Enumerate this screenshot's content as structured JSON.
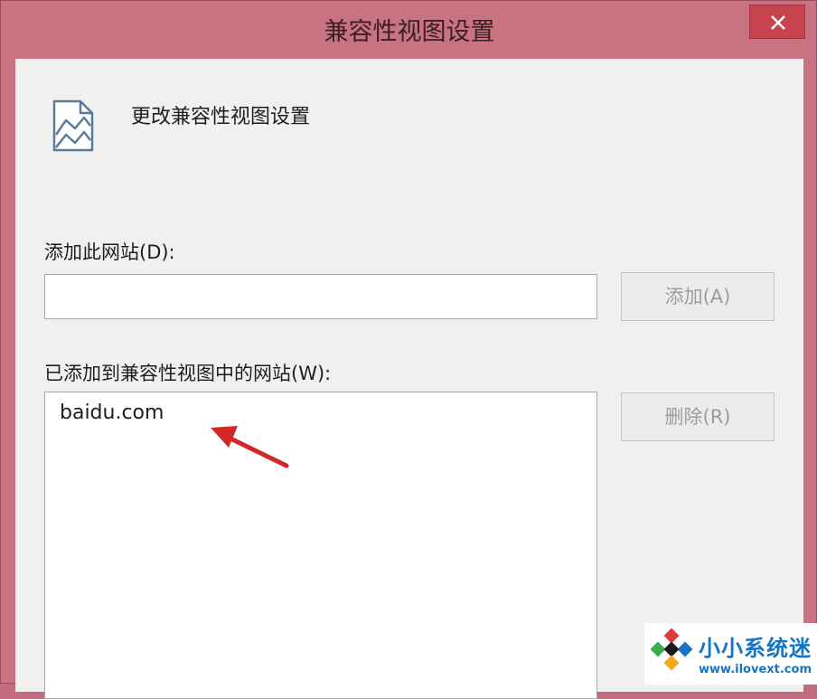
{
  "window": {
    "title": "兼容性视图设置",
    "close_icon": "close-icon"
  },
  "header": {
    "icon": "compat-view-icon",
    "text": "更改兼容性视图设置"
  },
  "add_site": {
    "label": "添加此网站(D):",
    "value": "",
    "button_label": "添加(A)"
  },
  "added_sites": {
    "label": "已添加到兼容性视图中的网站(W):",
    "items": [
      "baidu.com"
    ],
    "remove_button_label": "删除(R)"
  },
  "annotation": {
    "icon": "arrow-icon",
    "color": "#d32626"
  },
  "watermark": {
    "name": "小小系统迷",
    "url": "www.ilovext.com"
  },
  "colors": {
    "frame": "#c87282",
    "close_button": "#c7434d",
    "brand": "#1774c4"
  }
}
